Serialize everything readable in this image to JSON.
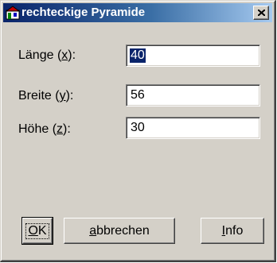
{
  "window": {
    "title": "rechteckige Pyramide",
    "icon": "pyramid-app-icon",
    "close_icon": "close-icon"
  },
  "fields": [
    {
      "label_pre": "Länge (",
      "label_key": "x",
      "label_post": "):",
      "value": "40",
      "selected": true
    },
    {
      "label_pre": "Breite (",
      "label_key": "y",
      "label_post": "):",
      "value": "56",
      "selected": false
    },
    {
      "label_pre": "Höhe (",
      "label_key": "z",
      "label_post": "):",
      "value": "30",
      "selected": false
    }
  ],
  "buttons": {
    "ok": {
      "key": "O",
      "rest": "K"
    },
    "cancel": {
      "key": "a",
      "rest": "bbrechen"
    },
    "info": {
      "key": "I",
      "rest": "nfo"
    }
  }
}
